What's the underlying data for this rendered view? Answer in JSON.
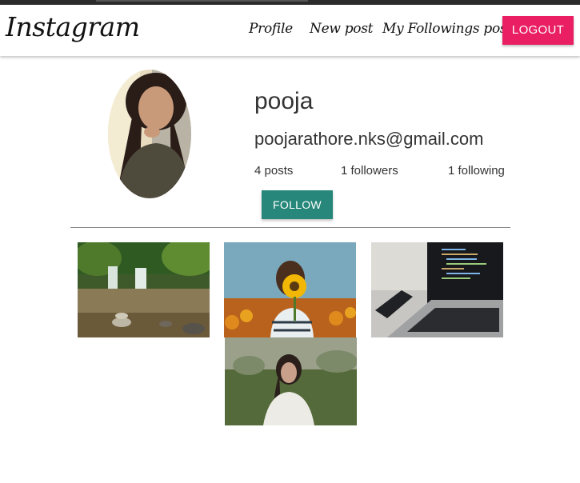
{
  "app": {
    "brand": "Instagram"
  },
  "nav": {
    "links": [
      {
        "label": "Profile"
      },
      {
        "label": "New post"
      },
      {
        "label": "My Followings post"
      }
    ],
    "logout_label": "LOGOUT",
    "logout_color": "#e91e63"
  },
  "profile": {
    "username": "pooja",
    "email": "poojarathore.nks@gmail.com",
    "stats": {
      "posts": "4 posts",
      "followers": "1 followers",
      "following": "1 following"
    },
    "follow_label": "FOLLOW",
    "follow_color": "#26877a"
  },
  "posts": [
    {
      "icon": "waterfall-photo"
    },
    {
      "icon": "sunflower-photo"
    },
    {
      "icon": "laptop-photo"
    },
    {
      "icon": "woman-in-field-photo"
    }
  ]
}
